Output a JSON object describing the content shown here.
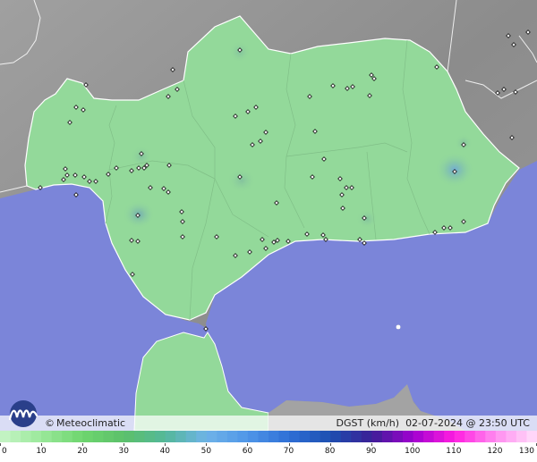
{
  "brand": {
    "copyright_symbol": "©",
    "name": "Meteoclimatic",
    "logo_icon": "meteoclimatic-wave-logo-icon"
  },
  "product": {
    "variable": "DGST (km/h)",
    "timestamp": "02-07-2024 @ 23:50 UTC"
  },
  "legend": {
    "min": 0,
    "max": 130,
    "tick_labels": [
      "0",
      "10",
      "20",
      "30",
      "40",
      "50",
      "60",
      "70",
      "80",
      "90",
      "100",
      "110",
      "120",
      "130"
    ],
    "tick_values": [
      0,
      10,
      20,
      30,
      40,
      50,
      60,
      70,
      80,
      90,
      100,
      110,
      120,
      130
    ],
    "color_stops": [
      {
        "value": 0,
        "color": "#c8f5c8"
      },
      {
        "value": 10,
        "color": "#9ae89a"
      },
      {
        "value": 20,
        "color": "#6ed66e"
      },
      {
        "value": 30,
        "color": "#5cc06a"
      },
      {
        "value": 40,
        "color": "#54b89a"
      },
      {
        "value": 50,
        "color": "#6fb3e8"
      },
      {
        "value": 60,
        "color": "#4f96e8"
      },
      {
        "value": 70,
        "color": "#2f6fd6"
      },
      {
        "value": 80,
        "color": "#1d4fb0"
      },
      {
        "value": 90,
        "color": "#3b1f96"
      },
      {
        "value": 100,
        "color": "#a000d0"
      },
      {
        "value": 110,
        "color": "#ff1ee0"
      },
      {
        "value": 120,
        "color": "#ff8cf0"
      },
      {
        "value": 130,
        "color": "#ffe0fa"
      }
    ]
  },
  "map_colors": {
    "sea": "#7b85d9",
    "land_outside": "#8b8b8b",
    "region_fill": "#93d99a",
    "region_border": "#ffffff"
  },
  "stations_count_note": ""
}
